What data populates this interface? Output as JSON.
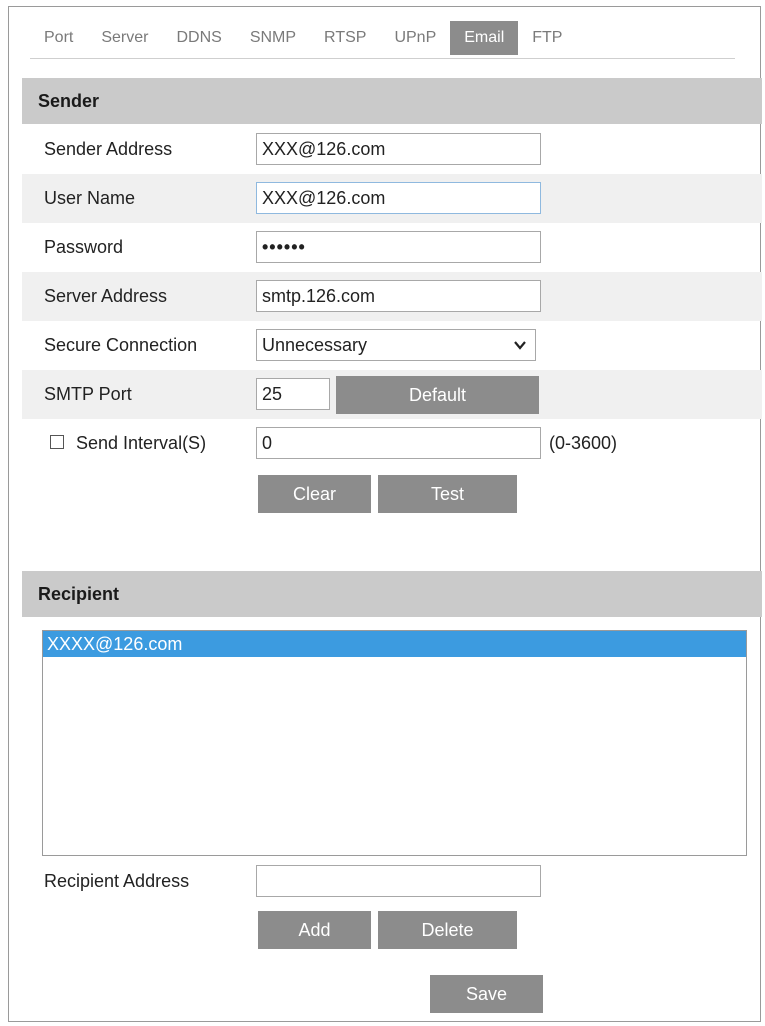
{
  "tabs": [
    {
      "label": "Port"
    },
    {
      "label": "Server"
    },
    {
      "label": "DDNS"
    },
    {
      "label": "SNMP"
    },
    {
      "label": "RTSP"
    },
    {
      "label": "UPnP"
    },
    {
      "label": "Email",
      "active": true
    },
    {
      "label": "FTP"
    }
  ],
  "sender": {
    "title": "Sender",
    "address_label": "Sender Address",
    "address_value": "XXX@126.com",
    "username_label": "User Name",
    "username_value": "XXX@126.com",
    "password_label": "Password",
    "password_value": "••••••",
    "server_label": "Server Address",
    "server_value": "smtp.126.com",
    "secure_label": "Secure Connection",
    "secure_value": "Unnecessary",
    "smtp_label": "SMTP Port",
    "smtp_value": "25",
    "default_label": "Default",
    "interval_label": "Send Interval(S)",
    "interval_value": "0",
    "interval_range": "(0-3600)",
    "clear_label": "Clear",
    "test_label": "Test"
  },
  "recipient": {
    "title": "Recipient",
    "list": [
      "XXXX@126.com"
    ],
    "address_label": "Recipient Address",
    "address_value": "",
    "add_label": "Add",
    "delete_label": "Delete"
  },
  "save_label": "Save",
  "colors": {
    "button": "#8c8c8c",
    "section_header": "#cacaca",
    "selection": "#3c9be0"
  }
}
